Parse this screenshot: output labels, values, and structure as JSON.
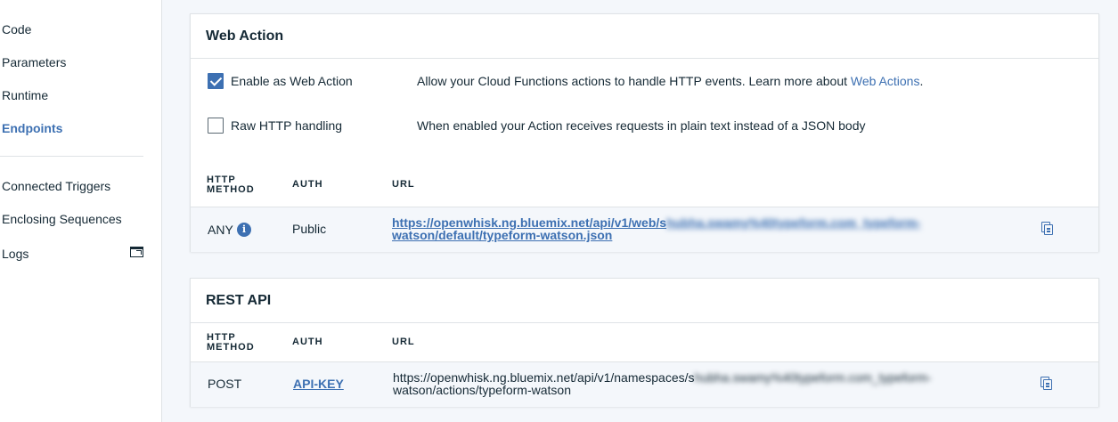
{
  "sidebar": {
    "items": [
      {
        "label": "Code"
      },
      {
        "label": "Parameters"
      },
      {
        "label": "Runtime"
      },
      {
        "label": "Endpoints",
        "active": true
      },
      {
        "label": "Connected Triggers"
      },
      {
        "label": "Enclosing Sequences"
      },
      {
        "label": "Logs"
      }
    ],
    "logs_icon": "external-window-icon"
  },
  "web_action": {
    "title": "Web Action",
    "enable": {
      "label": "Enable as Web Action",
      "checked": true,
      "desc_prefix": "Allow your Cloud Functions actions to handle HTTP events. Learn more about ",
      "desc_link": "Web Actions",
      "desc_suffix": "."
    },
    "raw": {
      "label": "Raw HTTP handling",
      "checked": false,
      "desc": "When enabled your Action receives requests in plain text instead of a JSON body"
    },
    "table": {
      "headers": {
        "method_1": "HTTP",
        "method_2": "METHOD",
        "auth": "AUTH",
        "url": "URL"
      },
      "row": {
        "method": "ANY",
        "info_icon": "i",
        "auth": "Public",
        "url_line1_visible": "https://openwhisk.ng.bluemix.net/api/v1/web/s",
        "url_line1_obscured": "hubha.swamy%40typeform.com_typeform-",
        "url_line2": "watson/default/typeform-watson.json",
        "copy_icon": "copy-icon"
      }
    }
  },
  "rest_api": {
    "title": "REST API",
    "table": {
      "headers": {
        "method_1": "HTTP",
        "method_2": "METHOD",
        "auth": "AUTH",
        "url": "URL"
      },
      "row": {
        "method": "POST",
        "auth": "API-KEY",
        "url_line1_visible": "https://openwhisk.ng.bluemix.net/api/v1/namespaces/s",
        "url_line1_obscured": "hubha.swamy%40typeform.com_typeform-",
        "url_line2": "watson/actions/typeform-watson",
        "copy_icon": "copy-icon"
      }
    }
  },
  "colors": {
    "accent": "#3d70b2",
    "text": "#152935",
    "row_bg": "#f4f7fb",
    "border": "#dfe3e6"
  }
}
